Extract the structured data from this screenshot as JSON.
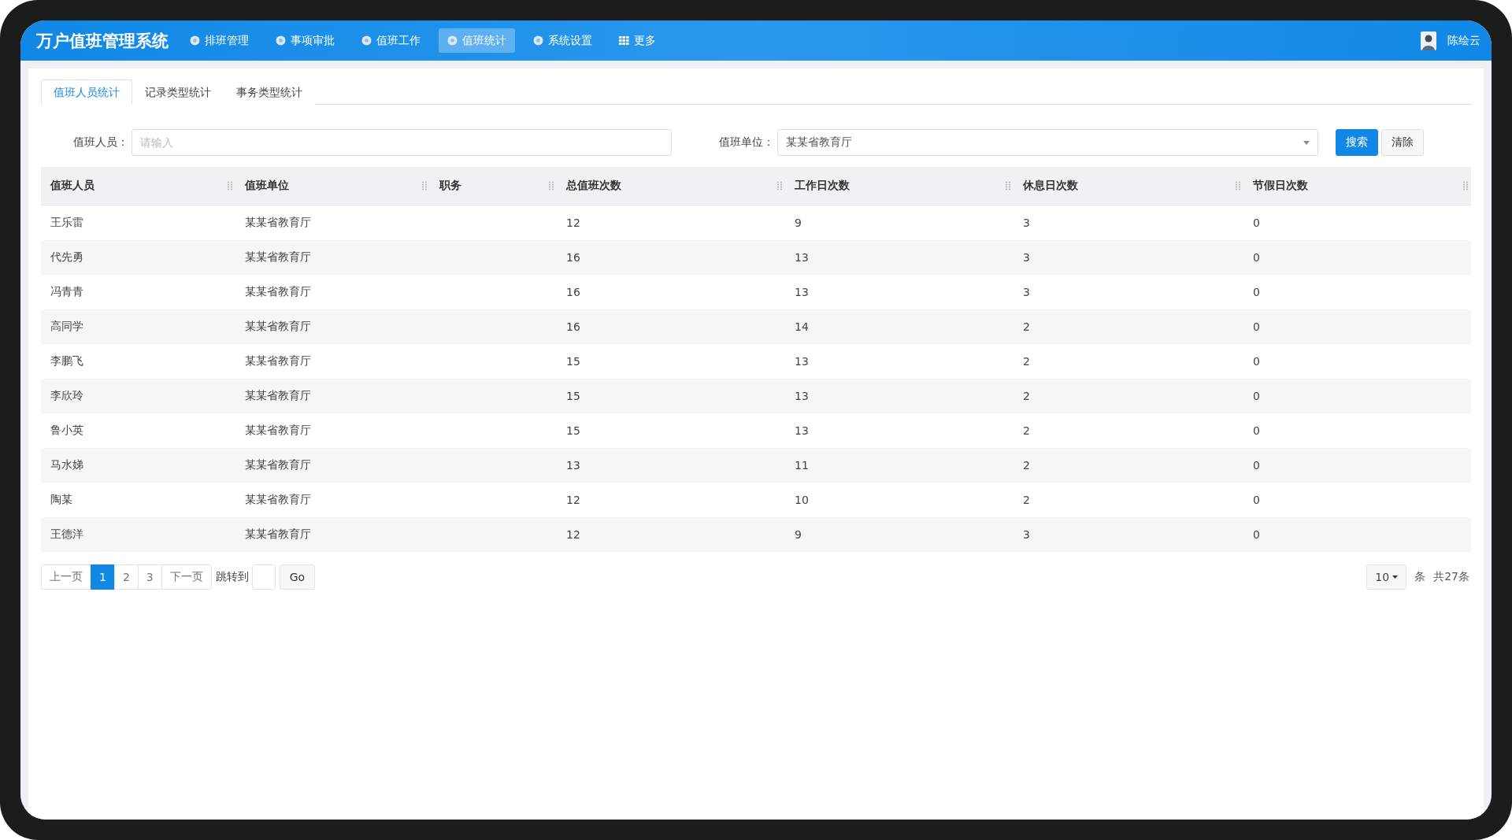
{
  "header": {
    "title": "万户值班管理系统",
    "nav": [
      {
        "label": "排班管理",
        "kind": "circle",
        "selected": false
      },
      {
        "label": "事项审批",
        "kind": "circle",
        "selected": false
      },
      {
        "label": "值班工作",
        "kind": "circle",
        "selected": false
      },
      {
        "label": "值班统计",
        "kind": "circle",
        "selected": true
      },
      {
        "label": "系统设置",
        "kind": "circle",
        "selected": false
      },
      {
        "label": "更多",
        "kind": "grid",
        "selected": false
      }
    ],
    "user": "陈绘云"
  },
  "tabs": [
    {
      "label": "值班人员统计",
      "selected": true
    },
    {
      "label": "记录类型统计",
      "selected": false
    },
    {
      "label": "事务类型统计",
      "selected": false
    }
  ],
  "filters": {
    "person": {
      "label": "值班人员：",
      "placeholder": "请输入"
    },
    "unit": {
      "label": "值班单位：",
      "value": "某某省教育厅"
    },
    "buttons": [
      {
        "label": "搜索",
        "kind": "primary"
      },
      {
        "label": "清除",
        "kind": "default"
      }
    ]
  },
  "table": {
    "columns": [
      "值班人员",
      "值班单位",
      "职务",
      "总值班次数",
      "工作日次数",
      "休息日次数",
      "节假日次数"
    ],
    "rows": [
      {
        "person": "王乐雷",
        "unit": "某某省教育厅",
        "total": "12",
        "workday": "9",
        "restday": "3",
        "holiday": "0"
      },
      {
        "person": "代先勇",
        "unit": "某某省教育厅",
        "total": "16",
        "workday": "13",
        "restday": "3",
        "holiday": "0"
      },
      {
        "person": "冯青青",
        "unit": "某某省教育厅",
        "total": "16",
        "workday": "13",
        "restday": "3",
        "holiday": "0"
      },
      {
        "person": "高同学",
        "unit": "某某省教育厅",
        "total": "16",
        "workday": "14",
        "restday": "2",
        "holiday": "0"
      },
      {
        "person": "李鹏飞",
        "unit": "某某省教育厅",
        "total": "15",
        "workday": "13",
        "restday": "2",
        "holiday": "0"
      },
      {
        "person": "李欣玲",
        "unit": "某某省教育厅",
        "total": "15",
        "workday": "13",
        "restday": "2",
        "holiday": "0"
      },
      {
        "person": "鲁小英",
        "unit": "某某省教育厅",
        "total": "15",
        "workday": "13",
        "restday": "2",
        "holiday": "0"
      },
      {
        "person": "马水娣",
        "unit": "某某省教育厅",
        "total": "13",
        "workday": "11",
        "restday": "2",
        "holiday": "0"
      },
      {
        "person": "陶某",
        "unit": "某某省教育厅",
        "total": "12",
        "workday": "10",
        "restday": "2",
        "holiday": "0"
      },
      {
        "person": "王德洋",
        "unit": "某某省教育厅",
        "total": "12",
        "workday": "9",
        "restday": "3",
        "holiday": "0"
      }
    ]
  },
  "pagination": {
    "prev": "上一页",
    "pages": [
      {
        "label": "1",
        "selected": true
      },
      {
        "label": "2",
        "selected": false
      },
      {
        "label": "3",
        "selected": false
      }
    ],
    "next": "下一页",
    "jump_label": "跳转到",
    "go": "Go",
    "page_size": "10",
    "unit": "条",
    "total": "共27条"
  }
}
